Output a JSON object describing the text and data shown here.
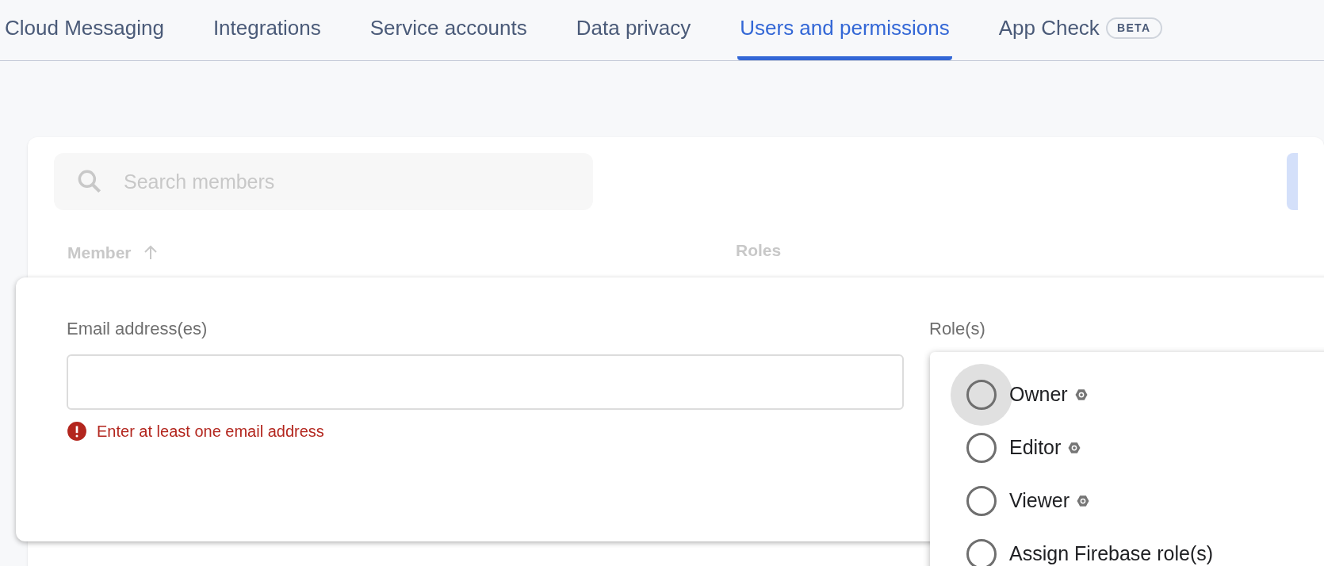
{
  "tabs": [
    {
      "label": "Cloud Messaging",
      "selected": false
    },
    {
      "label": "Integrations",
      "selected": false
    },
    {
      "label": "Service accounts",
      "selected": false
    },
    {
      "label": "Data privacy",
      "selected": false
    },
    {
      "label": "Users and permissions",
      "selected": true
    },
    {
      "label": "App Check",
      "selected": false,
      "badge": "BETA"
    }
  ],
  "search": {
    "placeholder": "Search members"
  },
  "table": {
    "columns": [
      {
        "label": "Member",
        "sorted": true
      },
      {
        "label": "Roles",
        "sorted": false
      }
    ]
  },
  "dialog": {
    "email_label": "Email address(es)",
    "error": "Enter at least one email address",
    "roles_label": "Role(s)",
    "roles": [
      {
        "label": "Owner",
        "selected": false,
        "focused": true,
        "info": true
      },
      {
        "label": "Editor",
        "selected": false,
        "focused": false,
        "info": true
      },
      {
        "label": "Viewer",
        "selected": false,
        "focused": false,
        "info": true
      },
      {
        "label": "Assign Firebase role(s)",
        "selected": false,
        "focused": false,
        "info": false
      }
    ]
  }
}
